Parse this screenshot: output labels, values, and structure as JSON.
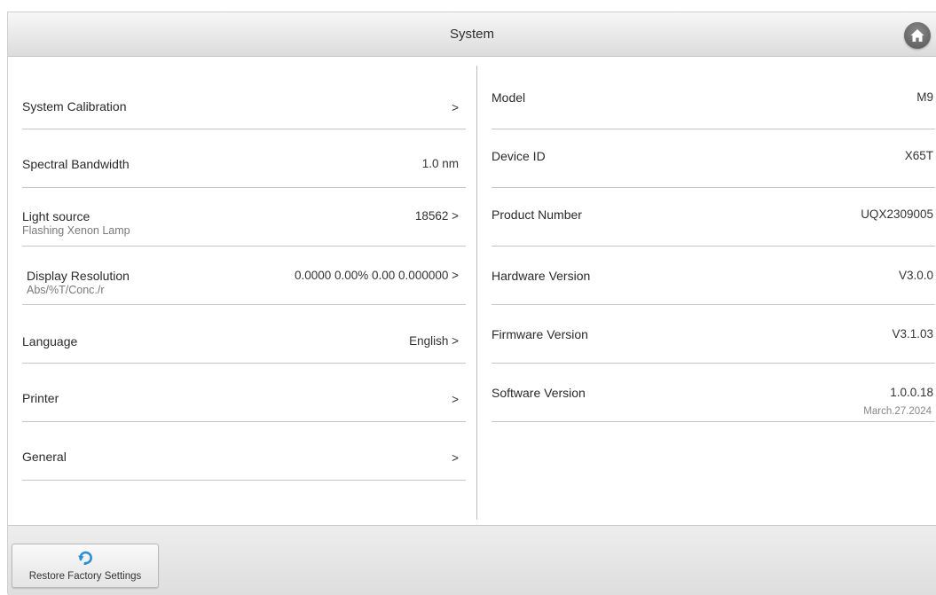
{
  "header": {
    "title": "System",
    "home_icon": "home-icon"
  },
  "left_panel": {
    "items": [
      {
        "label": "System Calibration",
        "sublabel": "",
        "value": ">"
      },
      {
        "label": "Spectral Bandwidth",
        "sublabel": "",
        "value": "1.0 nm"
      },
      {
        "label": "Light source",
        "sublabel": "Flashing Xenon Lamp",
        "value": "18562 >"
      },
      {
        "label": "Display Resolution",
        "sublabel": "Abs/%T/Conc./r",
        "value": "0.0000 0.00% 0.00 0.000000 >"
      },
      {
        "label": "Language",
        "sublabel": "",
        "value": "English >"
      },
      {
        "label": "Printer",
        "sublabel": "",
        "value": ">"
      },
      {
        "label": "General",
        "sublabel": "",
        "value": ">"
      }
    ]
  },
  "right_panel": {
    "items": [
      {
        "label": "Model",
        "value": "M9",
        "subvalue": ""
      },
      {
        "label": "Device ID",
        "value": "X65T",
        "subvalue": ""
      },
      {
        "label": "Product Number",
        "value": "UQX2309005",
        "subvalue": ""
      },
      {
        "label": "Hardware Version",
        "value": "V3.0.0",
        "subvalue": ""
      },
      {
        "label": "Firmware Version",
        "value": "V3.1.03",
        "subvalue": ""
      },
      {
        "label": "Software Version",
        "value": "1.0.0.18",
        "subvalue": "March.27.2024"
      }
    ]
  },
  "footer": {
    "restore_label": "Restore Factory Settings",
    "restore_icon": "restore-icon"
  },
  "colors": {
    "accent": "#2a8fd6",
    "divider": "#c6c6c6"
  }
}
